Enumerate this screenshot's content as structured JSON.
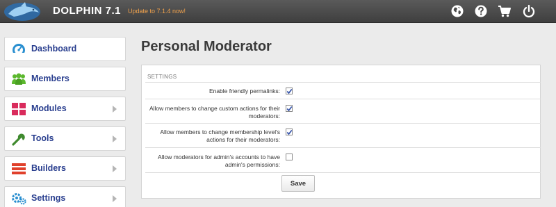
{
  "header": {
    "brand_name": "DOLPHIN",
    "version": "7.1",
    "update_link": "Update to 7.1.4 now!",
    "icons": [
      "globe-icon",
      "help-icon",
      "cart-icon",
      "power-icon"
    ]
  },
  "sidebar": {
    "items": [
      {
        "label": "Dashboard",
        "icon": "dashboard-icon",
        "has_arrow": false
      },
      {
        "label": "Members",
        "icon": "members-icon",
        "has_arrow": false
      },
      {
        "label": "Modules",
        "icon": "modules-icon",
        "has_arrow": true
      },
      {
        "label": "Tools",
        "icon": "tools-icon",
        "has_arrow": true
      },
      {
        "label": "Builders",
        "icon": "builders-icon",
        "has_arrow": true
      },
      {
        "label": "Settings",
        "icon": "settings-icon",
        "has_arrow": true
      }
    ]
  },
  "main": {
    "title": "Personal Moderator",
    "section_header": "SETTINGS",
    "settings": [
      {
        "line1": "Enable friendly permalinks:",
        "line2": "",
        "checked": true
      },
      {
        "line1": "Allow members to change custom actions for their",
        "line2": "moderators:",
        "checked": true
      },
      {
        "line1": "Allow members to change membership level's",
        "line2": "actions for their moderators:",
        "checked": true
      },
      {
        "line1": "Allow moderators for admin's accounts to have",
        "line2": "admin's permissions:",
        "checked": false
      }
    ],
    "save_label": "Save"
  },
  "colors": {
    "header_bg": "#4a4a4a",
    "menu_text": "#2a3f8f",
    "update_link": "#f0a14b",
    "dashboard_icon": "#2a8fd0",
    "members_icon": "#5cb82e",
    "modules_icon": "#d92b5c",
    "tools_icon": "#3f8a2e",
    "builders_icon": "#e0402b",
    "settings_icon": "#2a8fd0"
  }
}
